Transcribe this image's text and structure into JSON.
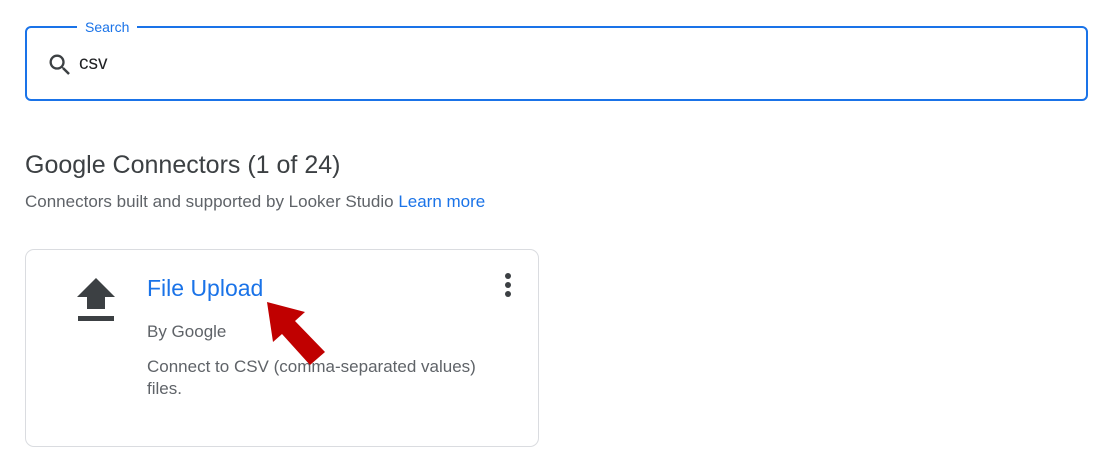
{
  "search": {
    "label": "Search",
    "value": "csv",
    "icon": "search-icon"
  },
  "section": {
    "title": "Google Connectors (1 of 24)",
    "subtitle": "Connectors built and supported by Looker Studio",
    "learn_more": "Learn more"
  },
  "connector": {
    "title": "File Upload",
    "author": "By Google",
    "description": "Connect to CSV (comma-separated values) files.",
    "icon": "upload-icon",
    "menu_icon": "more-vert-icon"
  },
  "colors": {
    "accent": "#1a73e8",
    "annotation": "#c00000"
  }
}
